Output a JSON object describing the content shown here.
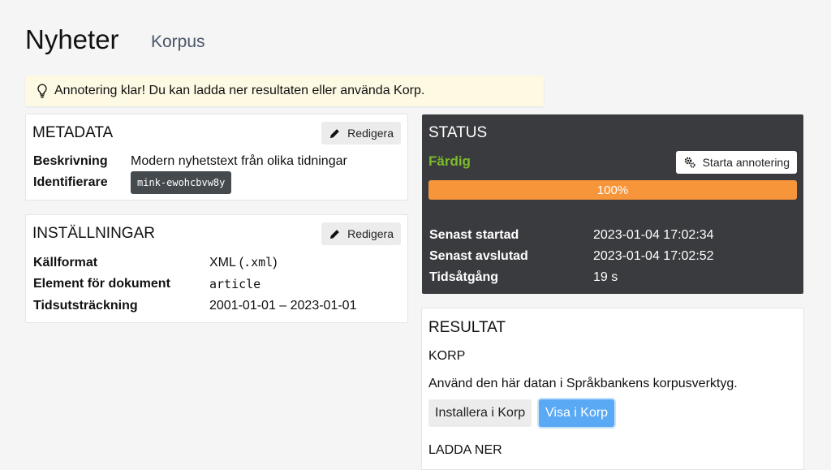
{
  "header": {
    "title": "Nyheter",
    "subtitle": "Korpus"
  },
  "notice": {
    "text": "Annotering klar! Du kan ladda ner resultaten eller använda Korp.",
    "icon": "lightbulb-icon"
  },
  "metadata": {
    "title": "METADATA",
    "edit_label": "Redigera",
    "description_label": "Beskrivning",
    "description_value": "Modern nyhetstext från olika tidningar",
    "identifier_label": "Identifierare",
    "identifier_value": "mink-ewohcbvw8y"
  },
  "settings": {
    "title": "INSTÄLLNINGAR",
    "edit_label": "Redigera",
    "format_label": "Källformat",
    "format_value_text": "XML (",
    "format_value_code": ".xml",
    "format_value_end": ")",
    "element_label": "Element för dokument",
    "element_value": "article",
    "timespan_label": "Tidsutsträckning",
    "timespan_value": "2001-01-01 – 2023-01-01"
  },
  "status": {
    "title": "STATUS",
    "state": "Färdig",
    "start_button": "Starta annotering",
    "progress": 100,
    "progress_label": "100%",
    "started_label": "Senast startad",
    "started_value": "2023-01-04 17:02:34",
    "finished_label": "Senast avslutad",
    "finished_value": "2023-01-04 17:02:52",
    "duration_label": "Tidsåtgång",
    "duration_value": "19 s",
    "colors": {
      "background": "#3a3b3e",
      "done": "#7cbb2c",
      "progress": "#f7953a"
    }
  },
  "result": {
    "title": "RESULTAT",
    "korp_heading": "KORP",
    "korp_text": "Använd den här datan i Språkbankens korpusverktyg.",
    "install_button": "Installera i Korp",
    "view_button": "Visa i Korp",
    "download_heading": "LADDA NER"
  }
}
